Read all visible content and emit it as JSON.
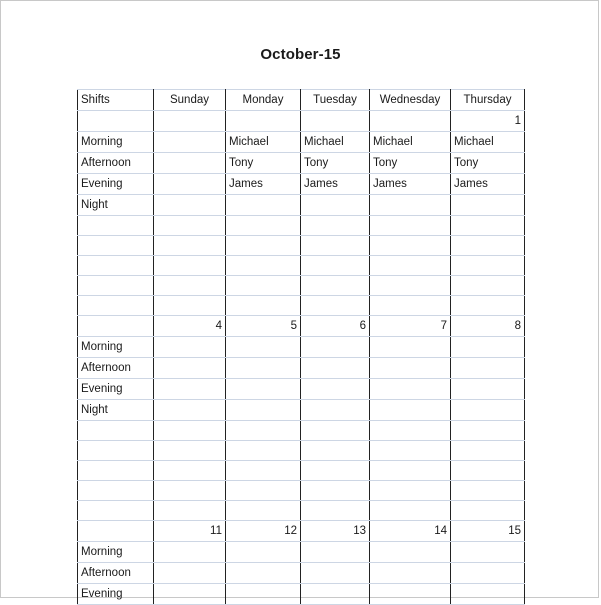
{
  "page": {
    "title": "October-15"
  },
  "table": {
    "columns": [
      {
        "key": "shifts",
        "label": "Shifts",
        "align": "left"
      },
      {
        "key": "sunday",
        "label": "Sunday",
        "align": "center"
      },
      {
        "key": "monday",
        "label": "Monday",
        "align": "center"
      },
      {
        "key": "tuesday",
        "label": "Tuesday",
        "align": "center"
      },
      {
        "key": "wednesday",
        "label": "Wednesday",
        "align": "center"
      },
      {
        "key": "thursday",
        "label": "Thursday",
        "align": "center"
      }
    ],
    "shift_names": [
      "Morning",
      "Afternoon",
      "Evening",
      "Night"
    ],
    "accent_color": "#e8912d",
    "gridline_color": "#cdd6e4",
    "border_color": "#222222",
    "weeks": [
      {
        "dates": [
          "",
          "",
          "",
          "",
          "",
          "1"
        ],
        "rows": [
          {
            "label": "Morning",
            "cells": [
              "",
              "Michael",
              "Michael",
              "Michael",
              "Michael"
            ]
          },
          {
            "label": "Afternoon",
            "cells": [
              "",
              "Tony",
              "Tony",
              "Tony",
              "Tony"
            ]
          },
          {
            "label": "Evening",
            "cells": [
              "",
              "James",
              "James",
              "James",
              "James"
            ]
          },
          {
            "label": "Night",
            "cells": [
              "",
              "",
              "",
              "",
              ""
            ]
          },
          {
            "label": "",
            "cells": [
              "",
              "",
              "",
              "",
              ""
            ]
          },
          {
            "label": "",
            "cells": [
              "",
              "",
              "",
              "",
              ""
            ]
          },
          {
            "label": "",
            "cells": [
              "",
              "",
              "",
              "",
              ""
            ]
          },
          {
            "label": "",
            "cells": [
              "",
              "",
              "",
              "",
              ""
            ]
          },
          {
            "label": "",
            "cells": [
              "",
              "",
              "",
              "",
              ""
            ]
          }
        ]
      },
      {
        "dates": [
          "",
          "4",
          "5",
          "6",
          "7",
          "8"
        ],
        "rows": [
          {
            "label": "Morning",
            "cells": [
              "",
              "",
              "",
              "",
              ""
            ]
          },
          {
            "label": "Afternoon",
            "cells": [
              "",
              "",
              "",
              "",
              ""
            ]
          },
          {
            "label": "Evening",
            "cells": [
              "",
              "",
              "",
              "",
              ""
            ]
          },
          {
            "label": "Night",
            "cells": [
              "",
              "",
              "",
              "",
              ""
            ]
          },
          {
            "label": "",
            "cells": [
              "",
              "",
              "",
              "",
              ""
            ]
          },
          {
            "label": "",
            "cells": [
              "",
              "",
              "",
              "",
              ""
            ]
          },
          {
            "label": "",
            "cells": [
              "",
              "",
              "",
              "",
              ""
            ]
          },
          {
            "label": "",
            "cells": [
              "",
              "",
              "",
              "",
              ""
            ]
          },
          {
            "label": "",
            "cells": [
              "",
              "",
              "",
              "",
              ""
            ]
          }
        ]
      },
      {
        "dates": [
          "",
          "11",
          "12",
          "13",
          "14",
          "15"
        ],
        "rows": [
          {
            "label": "Morning",
            "cells": [
              "",
              "",
              "",
              "",
              ""
            ]
          },
          {
            "label": "Afternoon",
            "cells": [
              "",
              "",
              "",
              "",
              ""
            ]
          },
          {
            "label": "Evening",
            "cells": [
              "",
              "",
              "",
              "",
              ""
            ]
          }
        ]
      }
    ]
  }
}
